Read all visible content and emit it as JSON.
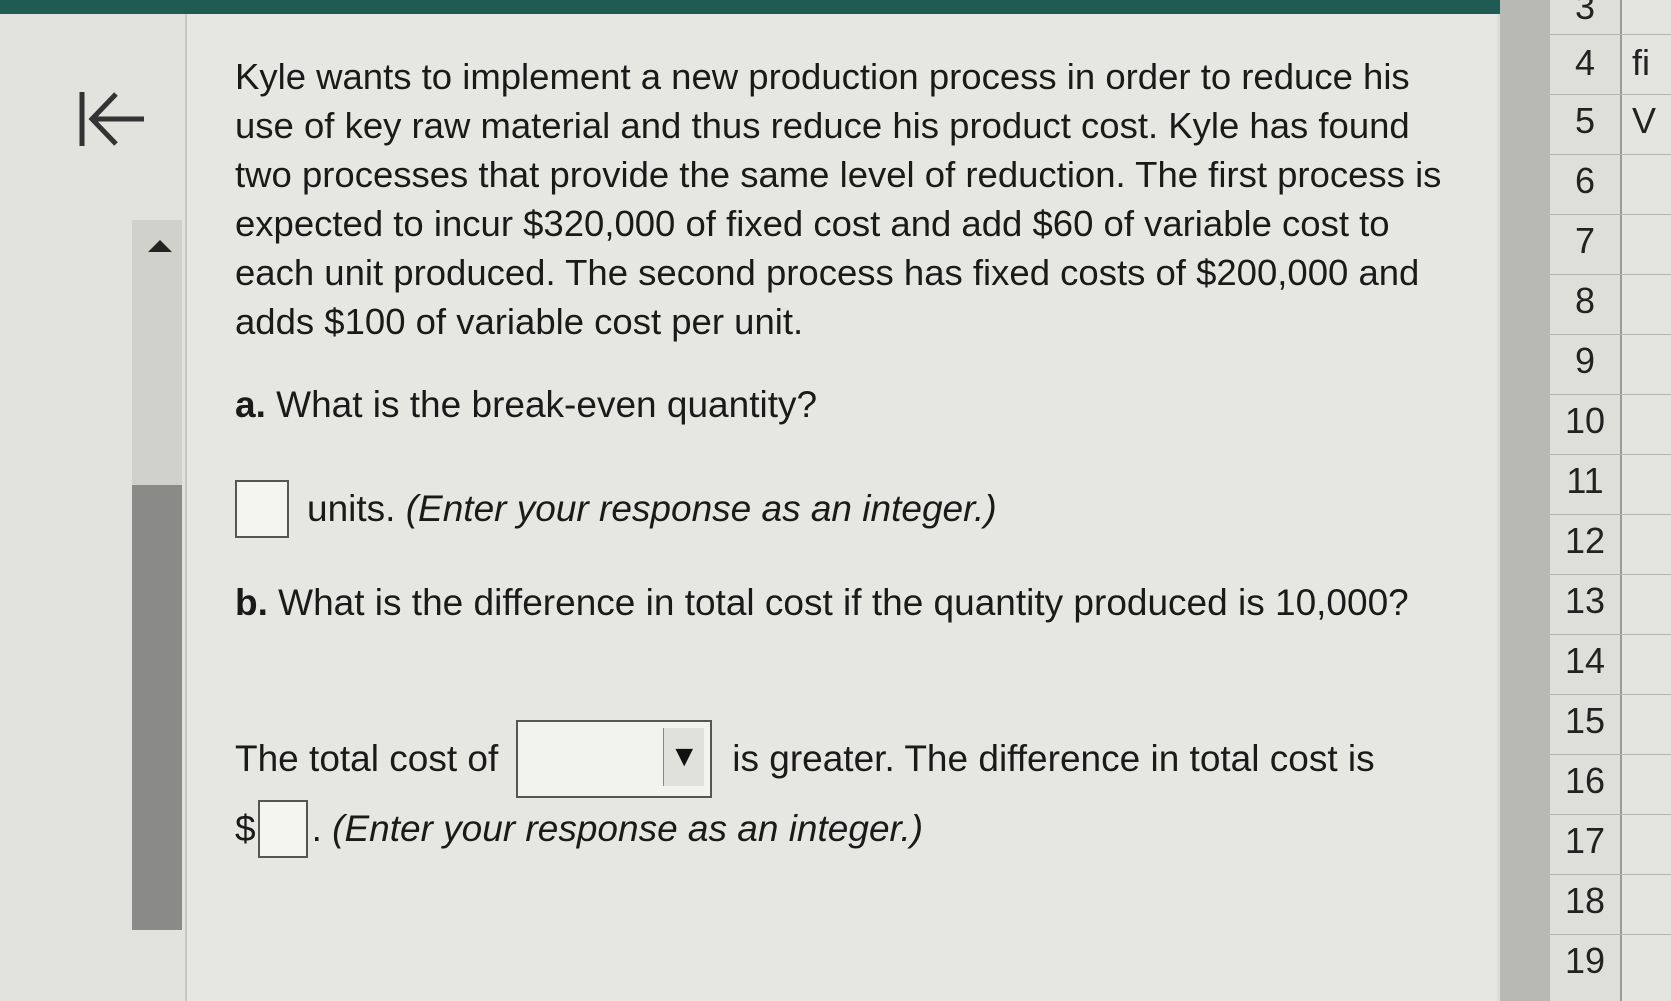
{
  "problem": {
    "intro": "Kyle wants to implement a new production process in order to reduce his use of key raw material and thus reduce his product cost. Kyle has found two processes that provide the same level of reduction. The first process is expected to incur $320,000 of fixed cost and add $60 of variable cost to each unit produced. The second process has fixed costs of $200,000 and adds $100 of variable cost per unit.",
    "part_a_label": "a.",
    "part_a_question": "What is the break-even quantity?",
    "part_a_answer": "",
    "part_a_suffix": "units.",
    "part_a_hint": "(Enter your response as an integer.)",
    "part_b_label": "b.",
    "part_b_question": "What is the difference in total cost if the quantity produced is 10,000?",
    "part_b_prefix": "The total cost of",
    "part_b_dropdown_value": "",
    "part_b_middle": "is greater. The difference in total cost is",
    "part_b_currency": "$",
    "part_b_answer": "",
    "part_b_period": ".",
    "part_b_hint": "(Enter your response as an integer.)"
  },
  "spreadsheet": {
    "row_numbers": [
      "3",
      "4",
      "5",
      "6",
      "7",
      "8",
      "9",
      "10",
      "11",
      "12",
      "13",
      "14",
      "15",
      "16",
      "17",
      "18",
      "19"
    ],
    "col_cells": [
      "fi",
      "V"
    ]
  },
  "icons": {
    "collapse": "collapse-left-icon",
    "scroll_up": "scroll-up-arrow-icon",
    "dropdown": "dropdown-arrow-icon"
  }
}
